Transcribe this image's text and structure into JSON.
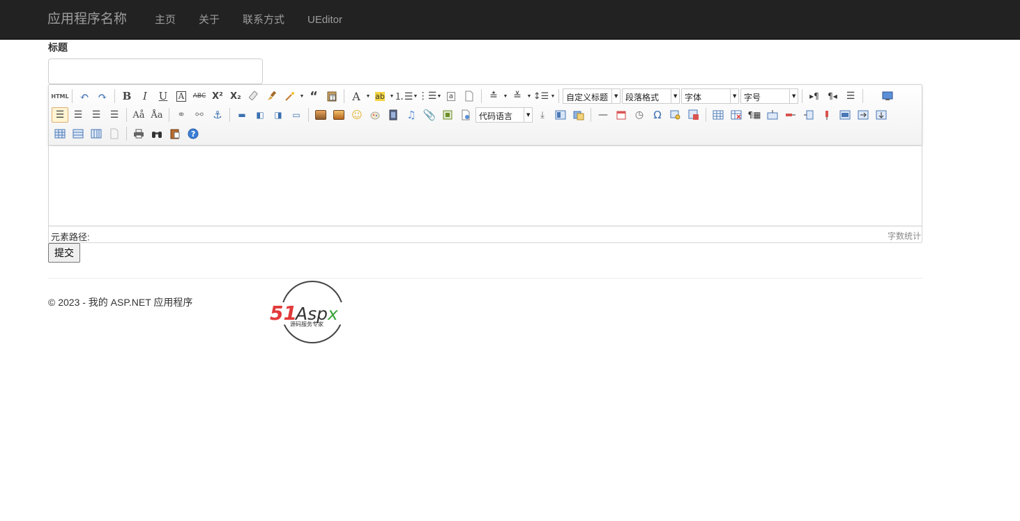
{
  "navbar": {
    "brand": "应用程序名称",
    "links": [
      "主页",
      "关于",
      "联系方式",
      "UEditor"
    ]
  },
  "form": {
    "title_label": "标题",
    "title_value": "",
    "submit_label": "提交"
  },
  "editor": {
    "combos": {
      "custom_heading": "自定义标题",
      "paragraph": "段落格式",
      "font_family": "字体",
      "font_size": "字号",
      "code_language": "代码语言"
    },
    "status": {
      "element_path": "元素路径:",
      "word_count": "字数统计"
    }
  },
  "footer": {
    "copyright": "© 2023 - 我的 ASP.NET 应用程序"
  },
  "logo": {
    "text_51": "51",
    "text_aspx": "Aspx",
    "tagline": "源码服务专家"
  },
  "colors": {
    "navbar_bg": "#222222",
    "nav_text": "#9d9d9d",
    "logo_red": "#e23a3a",
    "logo_green": "#3aa43a",
    "help_blue": "#3d7fd6"
  }
}
